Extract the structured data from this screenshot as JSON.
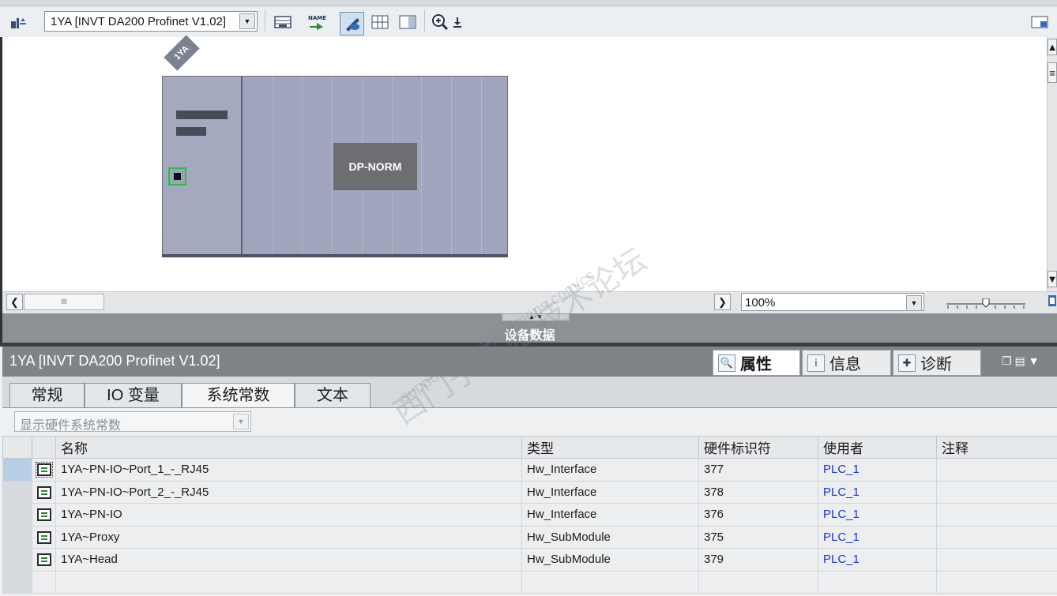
{
  "toolbar": {
    "device_selector": "1YA [INVT DA200 Profinet V1.02]"
  },
  "canvas": {
    "device_tag": "1YA",
    "module_label": "DP-NORM",
    "zoom": "100%"
  },
  "panel": {
    "splitter_title": "设备数据",
    "title": "1YA [INVT DA200 Profinet V1.02]",
    "tabs": [
      "属性",
      "信息",
      "诊断"
    ],
    "subtabs": [
      "常规",
      "IO 变量",
      "系统常数",
      "文本"
    ],
    "filter": "显示硬件系统常数"
  },
  "table": {
    "headers": [
      "名称",
      "类型",
      "硬件标识符",
      "使用者",
      "注释"
    ],
    "rows": [
      {
        "name": "1YA~PN-IO~Port_1_-_RJ45",
        "type": "Hw_Interface",
        "hwid": "377",
        "user": "PLC_1",
        "comment": ""
      },
      {
        "name": "1YA~PN-IO~Port_2_-_RJ45",
        "type": "Hw_Interface",
        "hwid": "378",
        "user": "PLC_1",
        "comment": ""
      },
      {
        "name": "1YA~PN-IO",
        "type": "Hw_Interface",
        "hwid": "376",
        "user": "PLC_1",
        "comment": ""
      },
      {
        "name": "1YA~Proxy",
        "type": "Hw_SubModule",
        "hwid": "375",
        "user": "PLC_1",
        "comment": ""
      },
      {
        "name": "1YA~Head",
        "type": "Hw_SubModule",
        "hwid": "379",
        "user": "PLC_1",
        "comment": ""
      }
    ]
  },
  "watermark": {
    "line1": "西门子工业  技术论坛",
    "line2": "support.industry.siemens.com/cs"
  },
  "colors": {
    "selection_frame": "#1fc43b",
    "link": "#1633d8",
    "module": "#a1a5bd"
  }
}
